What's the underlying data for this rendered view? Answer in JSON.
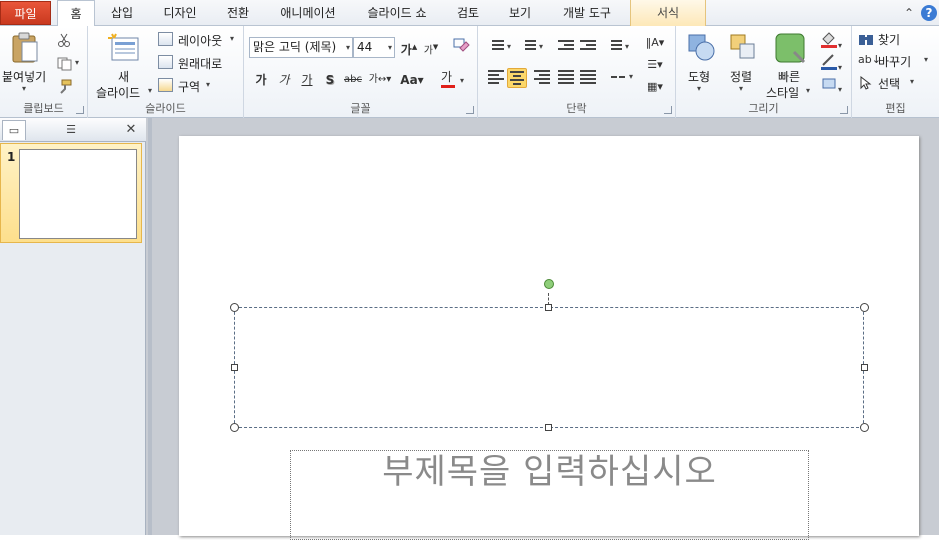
{
  "tabs": {
    "file": "파일",
    "home": "홈",
    "insert": "삽입",
    "design": "디자인",
    "transitions": "전환",
    "animations": "애니메이션",
    "slideshow": "슬라이드 쇼",
    "review": "검토",
    "view": "보기",
    "developer": "개발 도구",
    "format": "서식"
  },
  "clipboard": {
    "paste": "붙여넣기",
    "label": "클립보드"
  },
  "slides": {
    "new_slide_1": "새",
    "new_slide_2": "슬라이드",
    "layout": "레이아웃",
    "reset": "원래대로",
    "section": "구역",
    "label": "슬라이드"
  },
  "font": {
    "font_name": "맑은 고딕 (제목)",
    "font_size": "44",
    "label": "글꼴"
  },
  "paragraph": {
    "label": "단락"
  },
  "drawing": {
    "shapes": "도형",
    "arrange": "정렬",
    "quick_styles_1": "빠른",
    "quick_styles_2": "스타일",
    "label": "그리기"
  },
  "editing": {
    "find": "찾기",
    "replace": "바꾸기",
    "select": "선택",
    "label": "편집"
  },
  "pane": {
    "slide_number": "1"
  },
  "slide": {
    "subtitle_placeholder": "부제목을 입력하십시오"
  },
  "colors": {
    "file_tab": "#d5472b",
    "selection": "#fbd76a",
    "font_color_bar": "#e0201a"
  }
}
